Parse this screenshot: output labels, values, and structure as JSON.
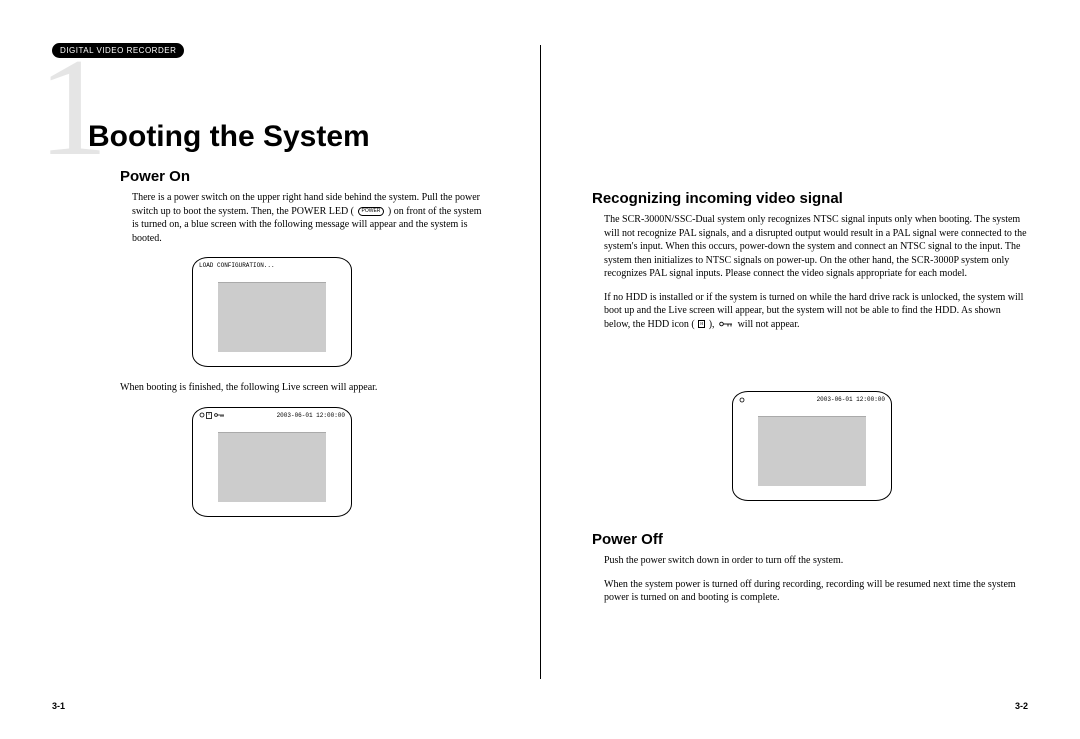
{
  "header_tab": "DIGITAL VIDEO RECORDER",
  "chapter": {
    "number": "1",
    "title": "Booting the System"
  },
  "left": {
    "power_on_title": "Power On",
    "power_on_text_1": "There is a power switch on the upper right hand side behind the system. Pull the power switch up to boot the system. Then, the POWER LED (",
    "power_on_text_2": ") on front of the system is turned on, a blue screen with the following message will appear and the system is booted.",
    "led_label": "POWER",
    "screen1_text": "LOAD CONFIGURATION...",
    "mid_text": "When booting is finished, the following Live screen will appear.",
    "screen2_timestamp": "2003-06-01 12:00:00"
  },
  "right": {
    "recognize_title": "Recognizing incoming video signal",
    "recognize_p1": "The SCR-3000N/SSC-Dual system only recognizes NTSC signal inputs only when booting. The system will not recognize PAL signals, and a disrupted output would result in a PAL signal were connected to the system's input. When this occurs, power-down the system and connect an NTSC signal to the input. The system then initializes to NTSC signals on power-up. On the other hand, the SCR-3000P system only recognizes PAL signal inputs. Please connect the video signals  appropriate for each model.",
    "recognize_p2a": "If no HDD is installed or if the system is turned on while the hard drive rack is unlocked, the system will boot up and the Live screen will appear, but the system will not be able to find the HDD. As shown below, the HDD icon (",
    "recognize_p2b": "),",
    "recognize_p2c": "will not appear.",
    "hdd_icon_label": "H",
    "screen3_timestamp": "2003-06-01 12:00:00",
    "power_off_title": "Power Off",
    "power_off_p1": "Push the power switch down in order to turn off the system.",
    "power_off_p2": "When the system power is turned off during recording, recording will be resumed next time the system power is turned on and booting is complete."
  },
  "page_numbers": {
    "left": "3-1",
    "right": "3-2"
  }
}
